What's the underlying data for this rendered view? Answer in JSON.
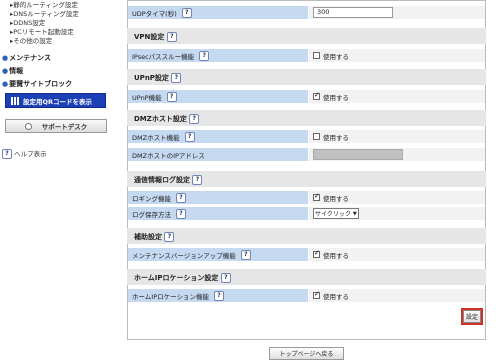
{
  "sidebar": {
    "sub_items": [
      "▸静的ルーティング設定",
      "▸DNSルーティング設定",
      "▸DDNS設定",
      "▸PCリモート起動設定",
      "▸その他の設定"
    ],
    "sections": [
      "メンテナンス",
      "情報",
      "要賛サイトブロック"
    ],
    "qr_button": "設定用QRコードを表示",
    "support_button": "サポートデスク",
    "help_label": "ヘルプ表示",
    "help_icon": "?"
  },
  "main": {
    "udp_label": "UDPタイマ(秒)",
    "udp_value": "300",
    "vpn": {
      "title": "VPN設定",
      "label": "IPsecパススルー機能",
      "option": "使用する",
      "checked": false
    },
    "upnp": {
      "title": "UPnP設定",
      "label": "UPnP機能",
      "option": "使用する",
      "checked": true
    },
    "dmz": {
      "title": "DMZホスト設定",
      "label1": "DMZホスト機能",
      "option": "使用する",
      "checked": false,
      "label2": "DMZホストのIPアドレス",
      "ip_value": ""
    },
    "log": {
      "title": "通信情報ログ設定",
      "label1": "ロギング機能",
      "option": "使用する",
      "checked": true,
      "label2": "ログ保存方法",
      "select_value": "サイクリック"
    },
    "aux": {
      "title": "補助設定",
      "label": "メンテナンスバージョンアップ機能",
      "option": "使用する",
      "checked": true
    },
    "homeip": {
      "title": "ホームIPロケーション設定",
      "label": "ホームIPロケーション機能",
      "option": "使用する",
      "checked": true
    },
    "set_button": "設定",
    "top_button": "トップページへ戻る"
  },
  "icons": {
    "help": "question-icon",
    "checkbox": "checkbox-icon"
  }
}
